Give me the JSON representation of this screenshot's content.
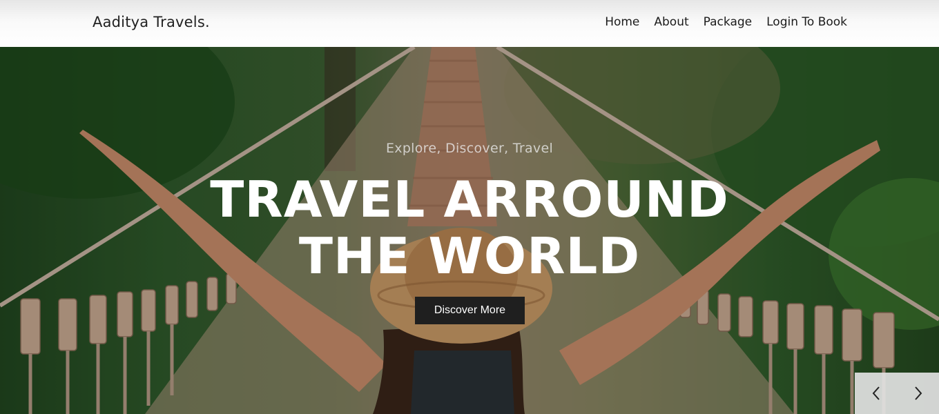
{
  "header": {
    "brand": "Aaditya Travels.",
    "nav": [
      "Home",
      "About",
      "Package",
      "Login To Book"
    ]
  },
  "hero": {
    "tagline": "Explore, Discover, Travel",
    "headline_line1": "TRAVEL ARROUND",
    "headline_line2": "THE WORLD",
    "cta_label": "Discover More",
    "background_image": "woman-on-suspension-bridge-photo"
  },
  "slider": {
    "prev_icon": "chevron-left-icon",
    "next_icon": "chevron-right-icon"
  },
  "colors": {
    "header_bg": "#f9f9f9",
    "cta_bg": "#1f1f1f",
    "headline": "#ffffff",
    "slider_bg": "#e2e2e2"
  }
}
